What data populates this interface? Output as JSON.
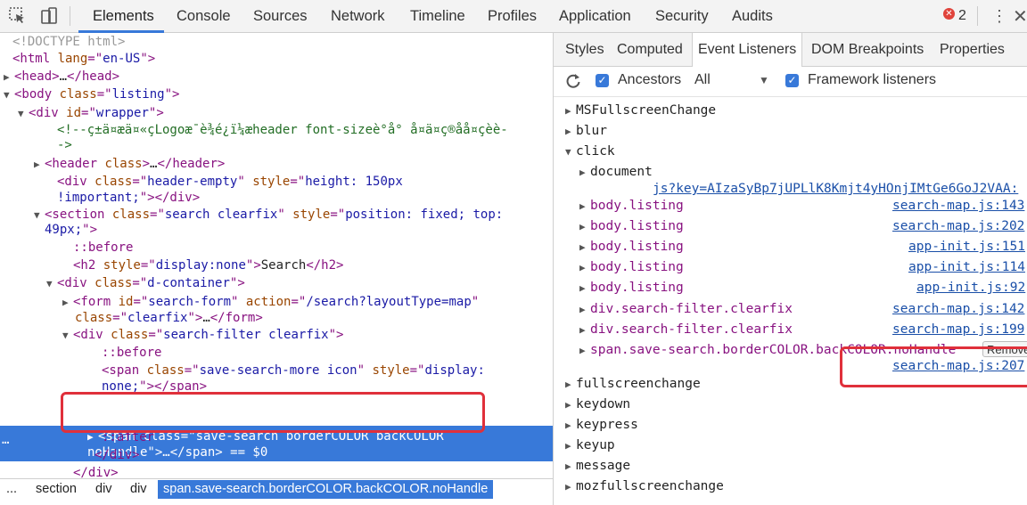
{
  "toolbar": {
    "tabs": [
      "Elements",
      "Console",
      "Sources",
      "Network",
      "Timeline",
      "Profiles",
      "Application",
      "Security",
      "Audits"
    ],
    "error_count": "2",
    "colors": {
      "accent": "#3879d9",
      "error": "#e0433b",
      "highlight_box": "#e0303b"
    }
  },
  "elements": {
    "lines": [
      {
        "indent": "",
        "arrow": "",
        "html": [
          [
            "t-gray",
            "<!DOCTYPE html>"
          ]
        ]
      },
      {
        "indent": "",
        "arrow": "",
        "html": [
          [
            "t-tag",
            "<html "
          ],
          [
            "t-attr",
            "lang"
          ],
          [
            "t-tag",
            "=\""
          ],
          [
            "t-val",
            "en-US"
          ],
          [
            "t-tag",
            "\">"
          ]
        ]
      },
      {
        "indent": "",
        "arrow": "▶",
        "html": [
          [
            "t-tag",
            "<head>"
          ],
          [
            "t-text",
            "…"
          ],
          [
            "t-tag",
            "</head>"
          ]
        ]
      },
      {
        "indent": "",
        "arrow": "▼",
        "html": [
          [
            "t-tag",
            "<body "
          ],
          [
            "t-attr",
            "class"
          ],
          [
            "t-tag",
            "=\""
          ],
          [
            "t-val",
            "listing"
          ],
          [
            "t-tag",
            "\">"
          ]
        ]
      },
      {
        "indent": "  ",
        "arrow": "▼",
        "html": [
          [
            "t-tag",
            "<div "
          ],
          [
            "t-attr",
            "id"
          ],
          [
            "t-tag",
            "=\""
          ],
          [
            "t-val",
            "wrapper"
          ],
          [
            "t-tag",
            "\">"
          ]
        ]
      },
      {
        "indent": "     ",
        "arrow": "",
        "html": [
          [
            "t-comment",
            "<!--ç±ä¤æä¤«çLogoæ¯è¾é¿ï¼æheader font-sizeè°å° å¤ä¤ç®åå¤çèè-"
          ]
        ]
      },
      {
        "indent": "     ",
        "arrow": "",
        "html": [
          [
            "t-comment",
            "->"
          ]
        ]
      },
      {
        "indent": "   ",
        "arrow": "▶",
        "html": [
          [
            "t-tag",
            "<header "
          ],
          [
            "t-attr",
            "class"
          ],
          [
            "t-tag",
            ">"
          ],
          [
            "t-text",
            "…"
          ],
          [
            "t-tag",
            "</header>"
          ]
        ]
      },
      {
        "indent": "     ",
        "arrow": "",
        "html": [
          [
            "t-tag",
            "<div "
          ],
          [
            "t-attr",
            "class"
          ],
          [
            "t-tag",
            "=\""
          ],
          [
            "t-val",
            "header-empty"
          ],
          [
            "t-tag",
            "\" "
          ],
          [
            "t-attr",
            "style"
          ],
          [
            "t-tag",
            "=\""
          ],
          [
            "t-val",
            "height: 150px"
          ]
        ]
      },
      {
        "indent": "     ",
        "arrow": "",
        "html": [
          [
            "t-val",
            "!important;"
          ],
          [
            "t-tag",
            "\"></div>"
          ]
        ]
      },
      {
        "indent": "   ",
        "arrow": "▼",
        "html": [
          [
            "t-tag",
            "<section "
          ],
          [
            "t-attr",
            "class"
          ],
          [
            "t-tag",
            "=\""
          ],
          [
            "t-val",
            "search clearfix"
          ],
          [
            "t-tag",
            "\" "
          ],
          [
            "t-attr",
            "style"
          ],
          [
            "t-tag",
            "=\""
          ],
          [
            "t-val",
            "position: fixed; top:"
          ]
        ]
      },
      {
        "indent": "   ",
        "arrow": "",
        "html": [
          [
            "t-val",
            "49px;"
          ],
          [
            "t-tag",
            "\">"
          ]
        ]
      },
      {
        "indent": "       ",
        "arrow": "",
        "html": [
          [
            "t-pseudo",
            "::before"
          ]
        ]
      },
      {
        "indent": "       ",
        "arrow": "",
        "html": [
          [
            "t-tag",
            "<h2 "
          ],
          [
            "t-attr",
            "style"
          ],
          [
            "t-tag",
            "=\""
          ],
          [
            "t-val",
            "display:none"
          ],
          [
            "t-tag",
            "\">"
          ],
          [
            "t-text",
            "Search"
          ],
          [
            "t-tag",
            "</h2>"
          ]
        ]
      },
      {
        "indent": "     ",
        "arrow": "▼",
        "html": [
          [
            "t-tag",
            "<div "
          ],
          [
            "t-attr",
            "class"
          ],
          [
            "t-tag",
            "=\""
          ],
          [
            "t-val",
            "d-container"
          ],
          [
            "t-tag",
            "\">"
          ]
        ]
      },
      {
        "indent": "       ",
        "arrow": "▶",
        "html": [
          [
            "t-tag",
            "<form "
          ],
          [
            "t-attr",
            "id"
          ],
          [
            "t-tag",
            "=\""
          ],
          [
            "t-val",
            "search-form"
          ],
          [
            "t-tag",
            "\" "
          ],
          [
            "t-attr",
            "action"
          ],
          [
            "t-tag",
            "=\""
          ],
          [
            "t-val",
            "/search?layoutType=map"
          ],
          [
            "t-tag",
            "\""
          ]
        ]
      },
      {
        "indent": "       ",
        "arrow": "",
        "html": [
          [
            "t-attr",
            "class"
          ],
          [
            "t-tag",
            "=\""
          ],
          [
            "t-val",
            "clearfix"
          ],
          [
            "t-tag",
            "\">"
          ],
          [
            "t-text",
            "…"
          ],
          [
            "t-tag",
            "</form>"
          ]
        ]
      },
      {
        "indent": "       ",
        "arrow": "▼",
        "html": [
          [
            "t-tag",
            "<div "
          ],
          [
            "t-attr",
            "class"
          ],
          [
            "t-tag",
            "=\""
          ],
          [
            "t-val",
            "search-filter clearfix"
          ],
          [
            "t-tag",
            "\">"
          ]
        ]
      },
      {
        "indent": "          ",
        "arrow": "",
        "html": [
          [
            "t-pseudo",
            "::before"
          ]
        ]
      },
      {
        "indent": "          ",
        "arrow": "",
        "html": [
          [
            "t-tag",
            "<span "
          ],
          [
            "t-attr",
            "class"
          ],
          [
            "t-tag",
            "=\""
          ],
          [
            "t-val",
            "save-search-more icon"
          ],
          [
            "t-tag",
            "\" "
          ],
          [
            "t-attr",
            "style"
          ],
          [
            "t-tag",
            "=\""
          ],
          [
            "t-val",
            "display:"
          ]
        ]
      },
      {
        "indent": "          ",
        "arrow": "",
        "html": [
          [
            "t-val",
            "none;"
          ],
          [
            "t-tag",
            "\"></span>"
          ]
        ]
      }
    ],
    "selected_line_1": "<span class=\"save-search borderCOLOR backCOLOR",
    "selected_line_2": "noHandle\">…</span> == $0",
    "after_lines": [
      {
        "indent": "          ",
        "arrow": "",
        "html": [
          [
            "t-pseudo",
            "::after"
          ]
        ]
      },
      {
        "indent": "         ",
        "arrow": "",
        "html": [
          [
            "t-tag",
            "</div>"
          ]
        ]
      },
      {
        "indent": "       ",
        "arrow": "",
        "html": [
          [
            "t-tag",
            "</div>"
          ]
        ]
      }
    ],
    "ellipsis": "…"
  },
  "breadcrumb": [
    "...",
    "section",
    "div",
    "div",
    "span.save-search.borderCOLOR.backCOLOR.noHandle"
  ],
  "sidebar": {
    "tabs": [
      "Styles",
      "Computed",
      "Event Listeners",
      "DOM Breakpoints",
      "Properties"
    ],
    "ancestors_label": "Ancestors",
    "filter_value": "All",
    "framework_label": "Framework listeners",
    "events_top": [
      "MSFullscreenChange",
      "blur"
    ],
    "click_label": "click",
    "click_items": [
      {
        "node": "document",
        "link": "js?key=AIzaSyBp7jUPLlK8Kmjt4yHOnjIMtGe6GoJ2VAA:"
      },
      {
        "node": "body.listing",
        "link": "search-map.js:143"
      },
      {
        "node": "body.listing",
        "link": "search-map.js:202"
      },
      {
        "node": "body.listing",
        "link": "app-init.js:151"
      },
      {
        "node": "body.listing",
        "link": "app-init.js:114"
      },
      {
        "node": "body.listing",
        "link": "app-init.js:92"
      },
      {
        "node": "div.search-filter.clearfix",
        "link": "search-map.js:142"
      },
      {
        "node": "div.search-filter.clearfix",
        "link": "search-map.js:199"
      },
      {
        "node": "span.save-search.borderCOLOR.backCOLOR.noHandle",
        "link": "search-map.js:207"
      }
    ],
    "remove_label": "Remove",
    "events_bottom": [
      "fullscreenchange",
      "keydown",
      "keypress",
      "keyup",
      "message",
      "mozfullscreenchange"
    ]
  }
}
